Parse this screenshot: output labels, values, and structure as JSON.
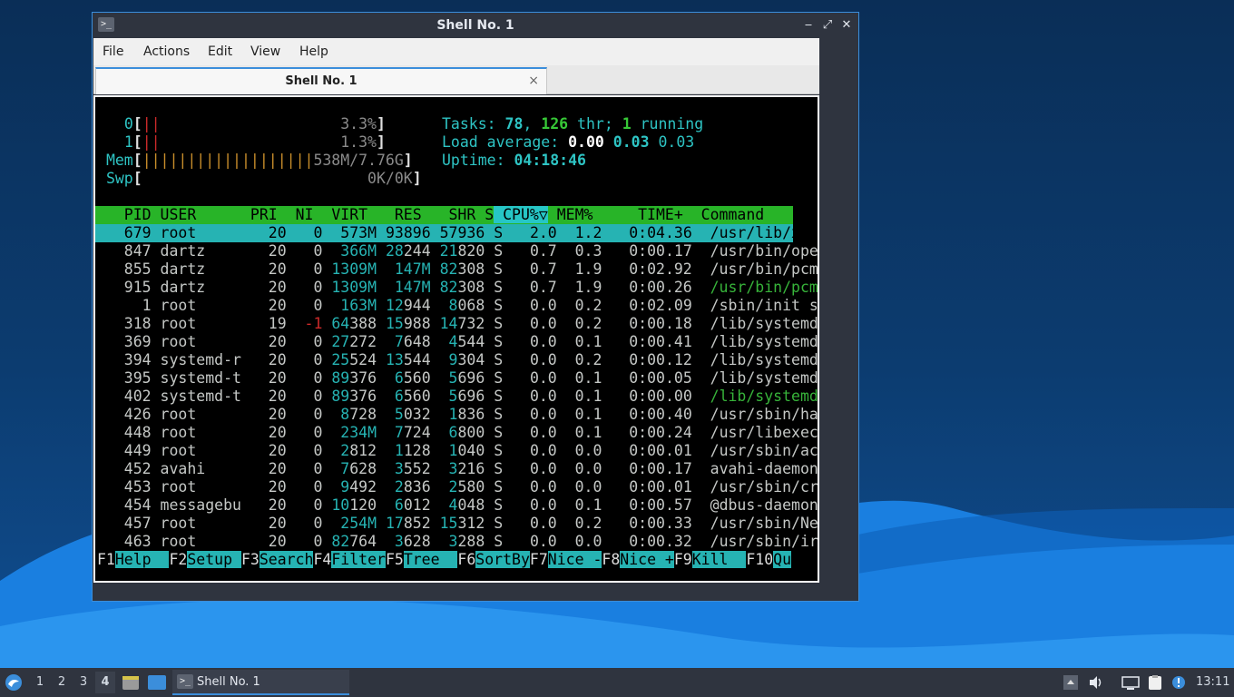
{
  "window": {
    "title": "Shell No. 1",
    "app_icon": ">_",
    "controls": {
      "minimize": "‒",
      "maximize": "⤢",
      "close": "✕"
    }
  },
  "menubar": [
    "File",
    "Actions",
    "Edit",
    "View",
    "Help"
  ],
  "tab": {
    "label": "Shell No. 1",
    "close": "×"
  },
  "htop": {
    "cpu0": {
      "label": "0",
      "bars": "||",
      "percent": "3.3%"
    },
    "cpu1": {
      "label": "1",
      "bars": "||",
      "percent": "1.3%"
    },
    "mem": {
      "label": "Mem",
      "bars": "|||||||||||||||||||",
      "value": "538M/7.76G"
    },
    "swp": {
      "label": "Swp",
      "value": "0K/0K"
    },
    "tasks": {
      "label": "Tasks:",
      "count": "78",
      "thr": "126",
      "thr_label": "thr;",
      "running": "1",
      "running_label": "running"
    },
    "load": {
      "label": "Load average:",
      "v1": "0.00",
      "v2": "0.03",
      "v3": "0.03"
    },
    "uptime": {
      "label": "Uptime:",
      "value": "04:18:46"
    },
    "columns": [
      "PID",
      "USER",
      "PRI",
      "NI",
      "VIRT",
      "RES",
      "SHR",
      "S",
      "CPU%▽",
      "MEM%",
      "TIME+",
      "Command"
    ],
    "processes": [
      {
        "pid": "679",
        "user": "root",
        "pri": "20",
        "ni": "0",
        "virt": "573M",
        "res": "93896",
        "shr": "57936",
        "s": "S",
        "cpu": "2.0",
        "mem": "1.2",
        "time": "0:04.36",
        "cmd": "/usr/lib/xor"
      },
      {
        "pid": "847",
        "user": "dartz",
        "pri": "20",
        "ni": "0",
        "virt": "366M",
        "res": "28244",
        "shr": "21820",
        "s": "S",
        "cpu": "0.7",
        "mem": "0.3",
        "time": "0:00.17",
        "cmd": "/usr/bin/ope"
      },
      {
        "pid": "855",
        "user": "dartz",
        "pri": "20",
        "ni": "0",
        "virt": "1309M",
        "res": "147M",
        "shr": "82308",
        "s": "S",
        "cpu": "0.7",
        "mem": "1.9",
        "time": "0:02.92",
        "cmd": "/usr/bin/pcm"
      },
      {
        "pid": "915",
        "user": "dartz",
        "pri": "20",
        "ni": "0",
        "virt": "1309M",
        "res": "147M",
        "shr": "82308",
        "s": "S",
        "cpu": "0.7",
        "mem": "1.9",
        "time": "0:00.26",
        "cmd": "/usr/bin/pcm"
      },
      {
        "pid": "1",
        "user": "root",
        "pri": "20",
        "ni": "0",
        "virt": "163M",
        "res": "12944",
        "shr": "8068",
        "s": "S",
        "cpu": "0.0",
        "mem": "0.2",
        "time": "0:02.09",
        "cmd": "/sbin/init s"
      },
      {
        "pid": "318",
        "user": "root",
        "pri": "19",
        "ni": "-1",
        "virt": "64388",
        "res": "15988",
        "shr": "14732",
        "s": "S",
        "cpu": "0.0",
        "mem": "0.2",
        "time": "0:00.18",
        "cmd": "/lib/systemd"
      },
      {
        "pid": "369",
        "user": "root",
        "pri": "20",
        "ni": "0",
        "virt": "27272",
        "res": "7648",
        "shr": "4544",
        "s": "S",
        "cpu": "0.0",
        "mem": "0.1",
        "time": "0:00.41",
        "cmd": "/lib/systemd"
      },
      {
        "pid": "394",
        "user": "systemd-r",
        "pri": "20",
        "ni": "0",
        "virt": "25524",
        "res": "13544",
        "shr": "9304",
        "s": "S",
        "cpu": "0.0",
        "mem": "0.2",
        "time": "0:00.12",
        "cmd": "/lib/systemd"
      },
      {
        "pid": "395",
        "user": "systemd-t",
        "pri": "20",
        "ni": "0",
        "virt": "89376",
        "res": "6560",
        "shr": "5696",
        "s": "S",
        "cpu": "0.0",
        "mem": "0.1",
        "time": "0:00.05",
        "cmd": "/lib/systemd"
      },
      {
        "pid": "402",
        "user": "systemd-t",
        "pri": "20",
        "ni": "0",
        "virt": "89376",
        "res": "6560",
        "shr": "5696",
        "s": "S",
        "cpu": "0.0",
        "mem": "0.1",
        "time": "0:00.00",
        "cmd": "/lib/systemd"
      },
      {
        "pid": "426",
        "user": "root",
        "pri": "20",
        "ni": "0",
        "virt": "8728",
        "res": "5032",
        "shr": "1836",
        "s": "S",
        "cpu": "0.0",
        "mem": "0.1",
        "time": "0:00.40",
        "cmd": "/usr/sbin/ha"
      },
      {
        "pid": "448",
        "user": "root",
        "pri": "20",
        "ni": "0",
        "virt": "234M",
        "res": "7724",
        "shr": "6800",
        "s": "S",
        "cpu": "0.0",
        "mem": "0.1",
        "time": "0:00.24",
        "cmd": "/usr/libexec"
      },
      {
        "pid": "449",
        "user": "root",
        "pri": "20",
        "ni": "0",
        "virt": "2812",
        "res": "1128",
        "shr": "1040",
        "s": "S",
        "cpu": "0.0",
        "mem": "0.0",
        "time": "0:00.01",
        "cmd": "/usr/sbin/ac"
      },
      {
        "pid": "452",
        "user": "avahi",
        "pri": "20",
        "ni": "0",
        "virt": "7628",
        "res": "3552",
        "shr": "3216",
        "s": "S",
        "cpu": "0.0",
        "mem": "0.0",
        "time": "0:00.17",
        "cmd": "avahi-daemon"
      },
      {
        "pid": "453",
        "user": "root",
        "pri": "20",
        "ni": "0",
        "virt": "9492",
        "res": "2836",
        "shr": "2580",
        "s": "S",
        "cpu": "0.0",
        "mem": "0.0",
        "time": "0:00.01",
        "cmd": "/usr/sbin/cr"
      },
      {
        "pid": "454",
        "user": "messagebu",
        "pri": "20",
        "ni": "0",
        "virt": "10120",
        "res": "6012",
        "shr": "4048",
        "s": "S",
        "cpu": "0.0",
        "mem": "0.1",
        "time": "0:00.57",
        "cmd": "@dbus-daemon"
      },
      {
        "pid": "457",
        "user": "root",
        "pri": "20",
        "ni": "0",
        "virt": "254M",
        "res": "17852",
        "shr": "15312",
        "s": "S",
        "cpu": "0.0",
        "mem": "0.2",
        "time": "0:00.33",
        "cmd": "/usr/sbin/Ne"
      },
      {
        "pid": "463",
        "user": "root",
        "pri": "20",
        "ni": "0",
        "virt": "82764",
        "res": "3628",
        "shr": "3288",
        "s": "S",
        "cpu": "0.0",
        "mem": "0.0",
        "time": "0:00.32",
        "cmd": "/usr/sbin/ir"
      }
    ],
    "fkeys": [
      {
        "key": "F1",
        "label": "Help  "
      },
      {
        "key": "F2",
        "label": "Setup "
      },
      {
        "key": "F3",
        "label": "Search"
      },
      {
        "key": "F4",
        "label": "Filter"
      },
      {
        "key": "F5",
        "label": "Tree  "
      },
      {
        "key": "F6",
        "label": "SortBy"
      },
      {
        "key": "F7",
        "label": "Nice -"
      },
      {
        "key": "F8",
        "label": "Nice +"
      },
      {
        "key": "F9",
        "label": "Kill  "
      },
      {
        "key": "F10",
        "label": "Qu"
      }
    ]
  },
  "taskbar": {
    "workspaces": [
      "1",
      "2",
      "3",
      "4"
    ],
    "active_workspace": "4",
    "task": "Shell No. 1",
    "clock": "13:11"
  },
  "colors": {
    "accent": "#3b8edb",
    "htop_header": "#28b428",
    "htop_selected": "#26b3b3",
    "terminal_bg": "#000000"
  }
}
